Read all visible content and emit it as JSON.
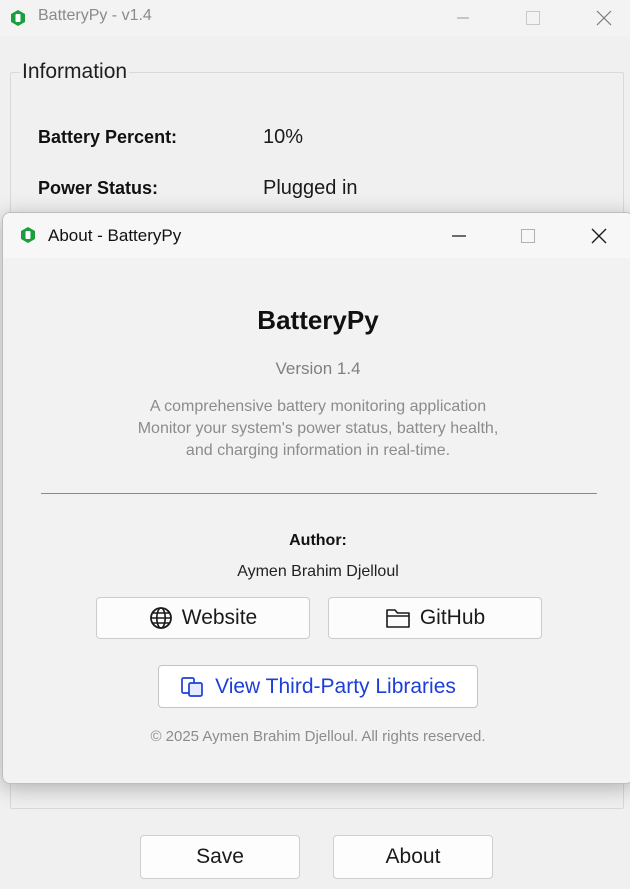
{
  "main_window": {
    "title": "BatteryPy - v1.4",
    "group_title": "Information",
    "rows": [
      {
        "label": "Battery Percent:",
        "value": "10%"
      },
      {
        "label": "Power Status:",
        "value": "Plugged in"
      }
    ],
    "buttons": {
      "save": "Save",
      "about": "About"
    }
  },
  "about_dialog": {
    "title": "About - BatteryPy",
    "app_name": "BatteryPy",
    "version": "Version 1.4",
    "description": [
      "A comprehensive battery monitoring application",
      "Monitor your system's power status, battery health,",
      "and charging information in real-time."
    ],
    "author_label": "Author:",
    "author_name": "Aymen Brahim Djelloul",
    "buttons": {
      "website": "Website",
      "github": "GitHub",
      "third_party": "View Third-Party Libraries"
    },
    "copyright": "© 2025 Aymen Brahim Djelloul. All rights reserved."
  },
  "colors": {
    "app_icon": "#1a9e3f",
    "link": "#1d3fd8"
  }
}
